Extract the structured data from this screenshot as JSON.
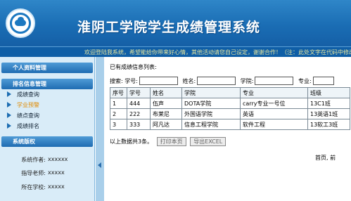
{
  "header": {
    "title": "淮阴工学院学生成绩管理系统"
  },
  "marquee": {
    "text": "欢迎登陆我系统，希望能给你带来好心情，其他活动请您自己设定，谢谢合作！（注：此处文字在代码中修改）"
  },
  "sidebar": {
    "personal_title": "个人资料管理",
    "ranking_title": "排名信息管理",
    "items": [
      {
        "label": "成绩查询"
      },
      {
        "label": "学业预警"
      },
      {
        "label": "绩点查询"
      },
      {
        "label": "成绩排名"
      }
    ],
    "copyright_title": "系统版权",
    "sysinfo": [
      {
        "key": "系统作者:",
        "value": "xxxxxx"
      },
      {
        "key": "指导老师:",
        "value": "xxxxx"
      },
      {
        "key": "所在学校:",
        "value": "xxxxx"
      }
    ]
  },
  "main": {
    "list_title": "已有成绩信息列表:",
    "search": {
      "label": "搜索:",
      "fields": [
        {
          "label": "学号:",
          "value": ""
        },
        {
          "label": "姓名:",
          "value": ""
        },
        {
          "label": "学院:",
          "value": ""
        },
        {
          "label": "专业:",
          "value": ""
        }
      ]
    },
    "table": {
      "headers": [
        "序号",
        "学号",
        "姓名",
        "学院",
        "专业",
        "班级"
      ],
      "rows": [
        [
          "1",
          "444",
          "伍声",
          "DOTA学院",
          "carry专业一号位",
          "13C1班"
        ],
        [
          "2",
          "222",
          "布莱尼",
          "外国语学院",
          "英语",
          "13英语1班"
        ],
        [
          "3",
          "333",
          "阿凡达",
          "信息工程学院",
          "软件工程",
          "13软工3班"
        ]
      ]
    },
    "footer": {
      "summary": "以上数据共3条。",
      "print_label": "打印本页",
      "export_label": "导出EXCEL"
    },
    "pager": {
      "first": "首页,",
      "prev": "前"
    }
  }
}
